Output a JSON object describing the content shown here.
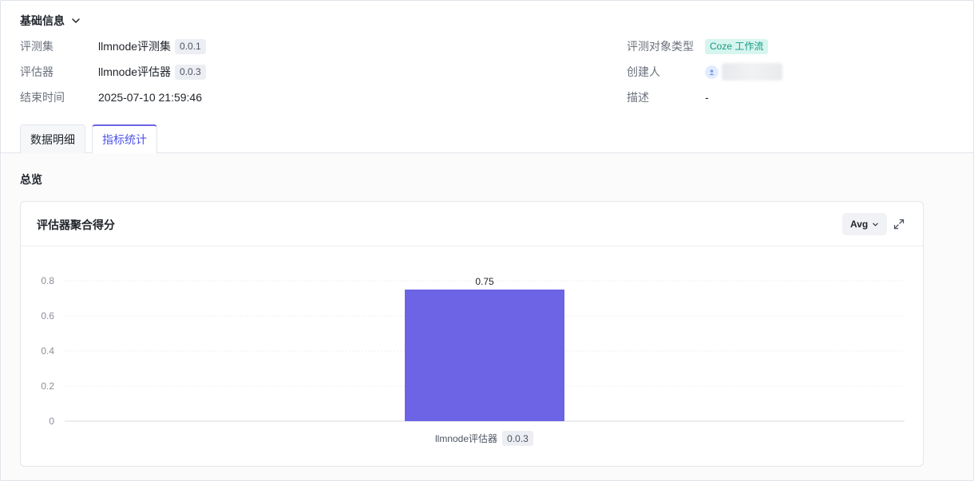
{
  "basic_info": {
    "title": "基础信息",
    "left": [
      {
        "label": "评测集",
        "value": "llmnode评测集",
        "version": "0.0.1"
      },
      {
        "label": "评估器",
        "value": "llmnode评估器",
        "version": "0.0.3"
      },
      {
        "label": "结束时间",
        "value": "2025-07-10 21:59:46"
      }
    ],
    "right": {
      "target_type_label": "评测对象类型",
      "target_type_value": "Coze 工作流",
      "creator_label": "创建人",
      "description_label": "描述",
      "description_value": "-"
    }
  },
  "tabs": [
    {
      "label": "数据明细",
      "active": false
    },
    {
      "label": "指标统计",
      "active": true
    }
  ],
  "overview": {
    "title": "总览",
    "card_title": "评估器聚合得分",
    "aggregation": "Avg"
  },
  "chart_data": {
    "type": "bar",
    "categories": [
      "llmnode评估器"
    ],
    "category_versions": [
      "0.0.3"
    ],
    "values": [
      0.75
    ],
    "data_labels": [
      "0.75"
    ],
    "y_ticks": [
      "0",
      "0.2",
      "0.4",
      "0.6",
      "0.8"
    ],
    "ylim": [
      0,
      0.8
    ],
    "grid": true,
    "bar_color": "#6c63e5"
  },
  "colors": {
    "accent": "#4d53e8",
    "tag_bg": "#d7f5ef",
    "tag_text": "#159a80"
  }
}
